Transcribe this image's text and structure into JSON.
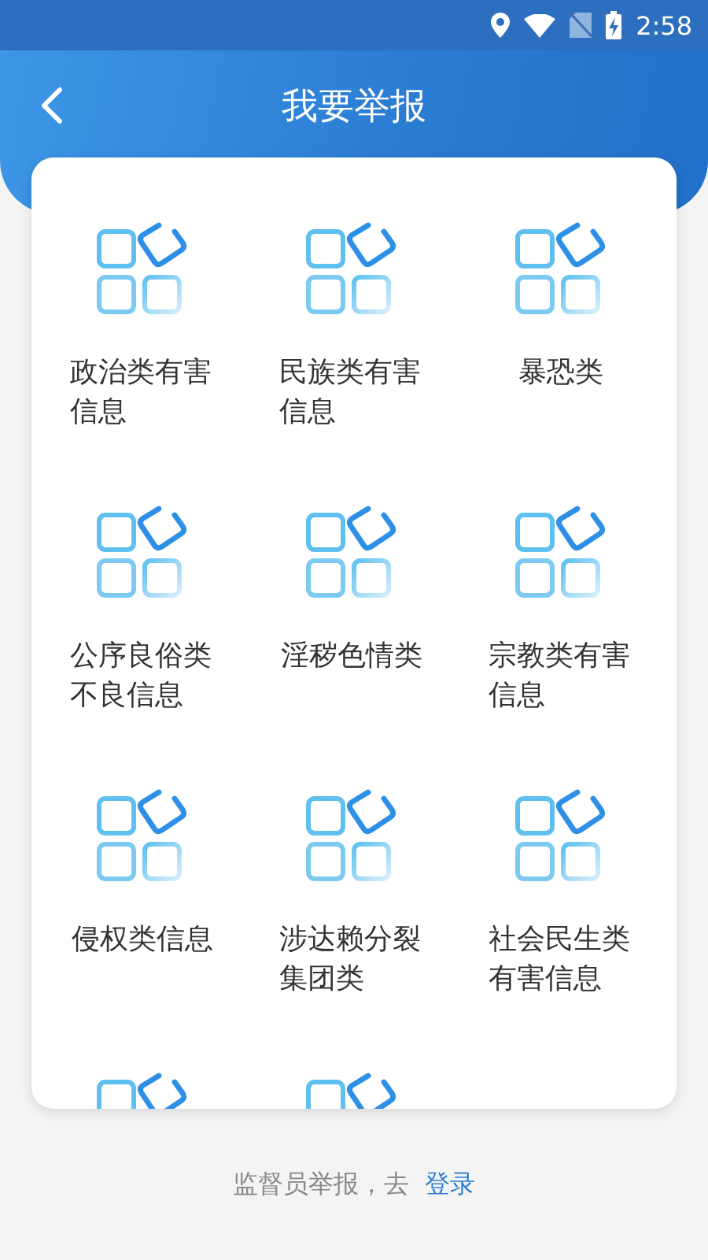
{
  "status_bar": {
    "time": "2:58"
  },
  "header": {
    "title": "我要举报"
  },
  "categories": [
    {
      "kind": "labeled",
      "label": "政治类有害信息"
    },
    {
      "kind": "labeled",
      "label": "民族类有害信息"
    },
    {
      "kind": "labeled",
      "label": "暴恐类"
    },
    {
      "kind": "labeled",
      "label": "公序良俗类不良信息"
    },
    {
      "kind": "labeled",
      "label": "淫秽色情类"
    },
    {
      "kind": "labeled",
      "label": "宗教类有害信息"
    },
    {
      "kind": "labeled",
      "label": "侵权类信息"
    },
    {
      "kind": "labeled",
      "label": "涉达赖分裂集团类"
    },
    {
      "kind": "labeled",
      "label": "社会民生类有害信息"
    },
    {
      "kind": "clipped"
    },
    {
      "kind": "clipped"
    }
  ],
  "footer": {
    "text": "监督员举报，去",
    "link": "登录"
  }
}
